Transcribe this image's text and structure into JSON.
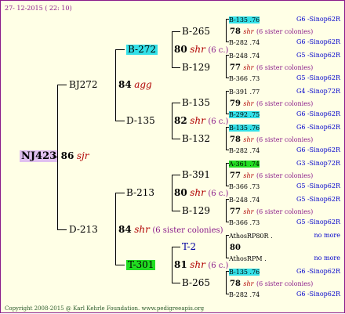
{
  "date": "27- 12-2015 ( 22: 10)",
  "footer": "Copyright 2008-2015 @ Karl Kehrle Foundation.   www.pedigreeapis.org",
  "root": {
    "label": "NJ423",
    "num": "86",
    "code": "sjr"
  },
  "gen1": [
    {
      "label": "BJ272",
      "num": "84",
      "code": "agg"
    },
    {
      "label": "D-213",
      "num": "84",
      "code": "shr",
      "colonies": "(6 sister colonies)"
    }
  ],
  "gen2": [
    {
      "label": "B-272",
      "num": "80",
      "code": "shr",
      "colonies": "(6 c.)",
      "highlight": "cyan"
    },
    {
      "label": "D-135",
      "num": "82",
      "code": "shr",
      "colonies": "(6 c.)"
    },
    {
      "label": "B-213",
      "num": "80",
      "code": "shr",
      "colonies": "(6 c.)"
    },
    {
      "label": "T-301",
      "num": "81",
      "code": "shr",
      "colonies": "(6 c.)",
      "highlight": "green"
    }
  ],
  "gen3": [
    {
      "label": "B-265",
      "num": "78",
      "code": "shr",
      "colonies": "(6 sister colonies)"
    },
    {
      "label": "B-129",
      "num": "77",
      "code": "shr",
      "colonies": "(6 sister colonies)"
    },
    {
      "label": "B-135",
      "num": "79",
      "code": "shr",
      "colonies": "(6 sister colonies)"
    },
    {
      "label": "B-132",
      "num": "78",
      "code": "shr",
      "colonies": "(6 sister colonies)"
    },
    {
      "label": "B-391",
      "num": "77",
      "code": "shr",
      "colonies": "(6 sister colonies)"
    },
    {
      "label": "B-129",
      "num": "77",
      "code": "shr",
      "colonies": "(6 sister colonies)"
    },
    {
      "label": "T-2",
      "num": "80",
      "code": "",
      "colonies": ""
    },
    {
      "label": "B-265",
      "num": "78",
      "code": "shr",
      "colonies": "(6 sister colonies)"
    }
  ],
  "gen4": [
    {
      "label": "B-135 .76",
      "right": "G6 -Sinop62R",
      "highlight": "cyan"
    },
    {
      "label": "B-282 .74",
      "right": "G6 -Sinop62R"
    },
    {
      "label": "B-248 .74",
      "right": "G5 -Sinop62R"
    },
    {
      "label": "B-366 .73",
      "right": "G5 -Sinop62R"
    },
    {
      "label": "B-391 .77",
      "right": "G4 -Sinop72R"
    },
    {
      "label": "B-292 .75",
      "right": "G6 -Sinop62R",
      "highlight": "cyan"
    },
    {
      "label": "B-135 .76",
      "right": "G6 -Sinop62R",
      "highlight": "cyan"
    },
    {
      "label": "B-282 .74",
      "right": "G6 -Sinop62R"
    },
    {
      "label": "A-361 .74",
      "right": "G3 -Sinop72R",
      "highlight": "green"
    },
    {
      "label": "B-366 .73",
      "right": "G5 -Sinop62R"
    },
    {
      "label": "B-248 .74",
      "right": "G5 -Sinop62R"
    },
    {
      "label": "B-366 .73",
      "right": "G5 -Sinop62R"
    },
    {
      "label": "AthosRP80R .",
      "right": "no more"
    },
    {
      "label": "AthosRPM .",
      "right": "no more"
    },
    {
      "label": "B-135 .76",
      "right": "G6 -Sinop62R",
      "highlight": "cyan"
    },
    {
      "label": "B-282 .74",
      "right": "G6 -Sinop62R"
    }
  ]
}
